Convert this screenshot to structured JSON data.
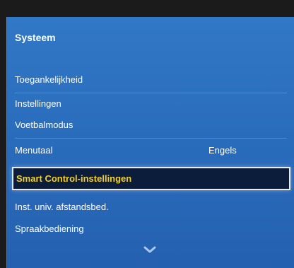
{
  "menu": {
    "title": "Systeem",
    "items": [
      {
        "label": "Toegankelijkheid",
        "value": ""
      },
      {
        "label": "Instellingen",
        "value": ""
      },
      {
        "label": "Voetbalmodus",
        "value": ""
      },
      {
        "label": "Menutaal",
        "value": "Engels"
      },
      {
        "label": "Smart Control-instellingen",
        "value": ""
      },
      {
        "label": "Inst. univ. afstandsbed.",
        "value": ""
      },
      {
        "label": "Spraakbediening",
        "value": ""
      }
    ],
    "selected_index": 4,
    "scroll_icon": "chevron-down-icon"
  },
  "colors": {
    "panel": "#2b6fc0",
    "highlight_bg": "#0b1d3a",
    "highlight_text": "#f3cf2a",
    "text": "#ffffff"
  }
}
